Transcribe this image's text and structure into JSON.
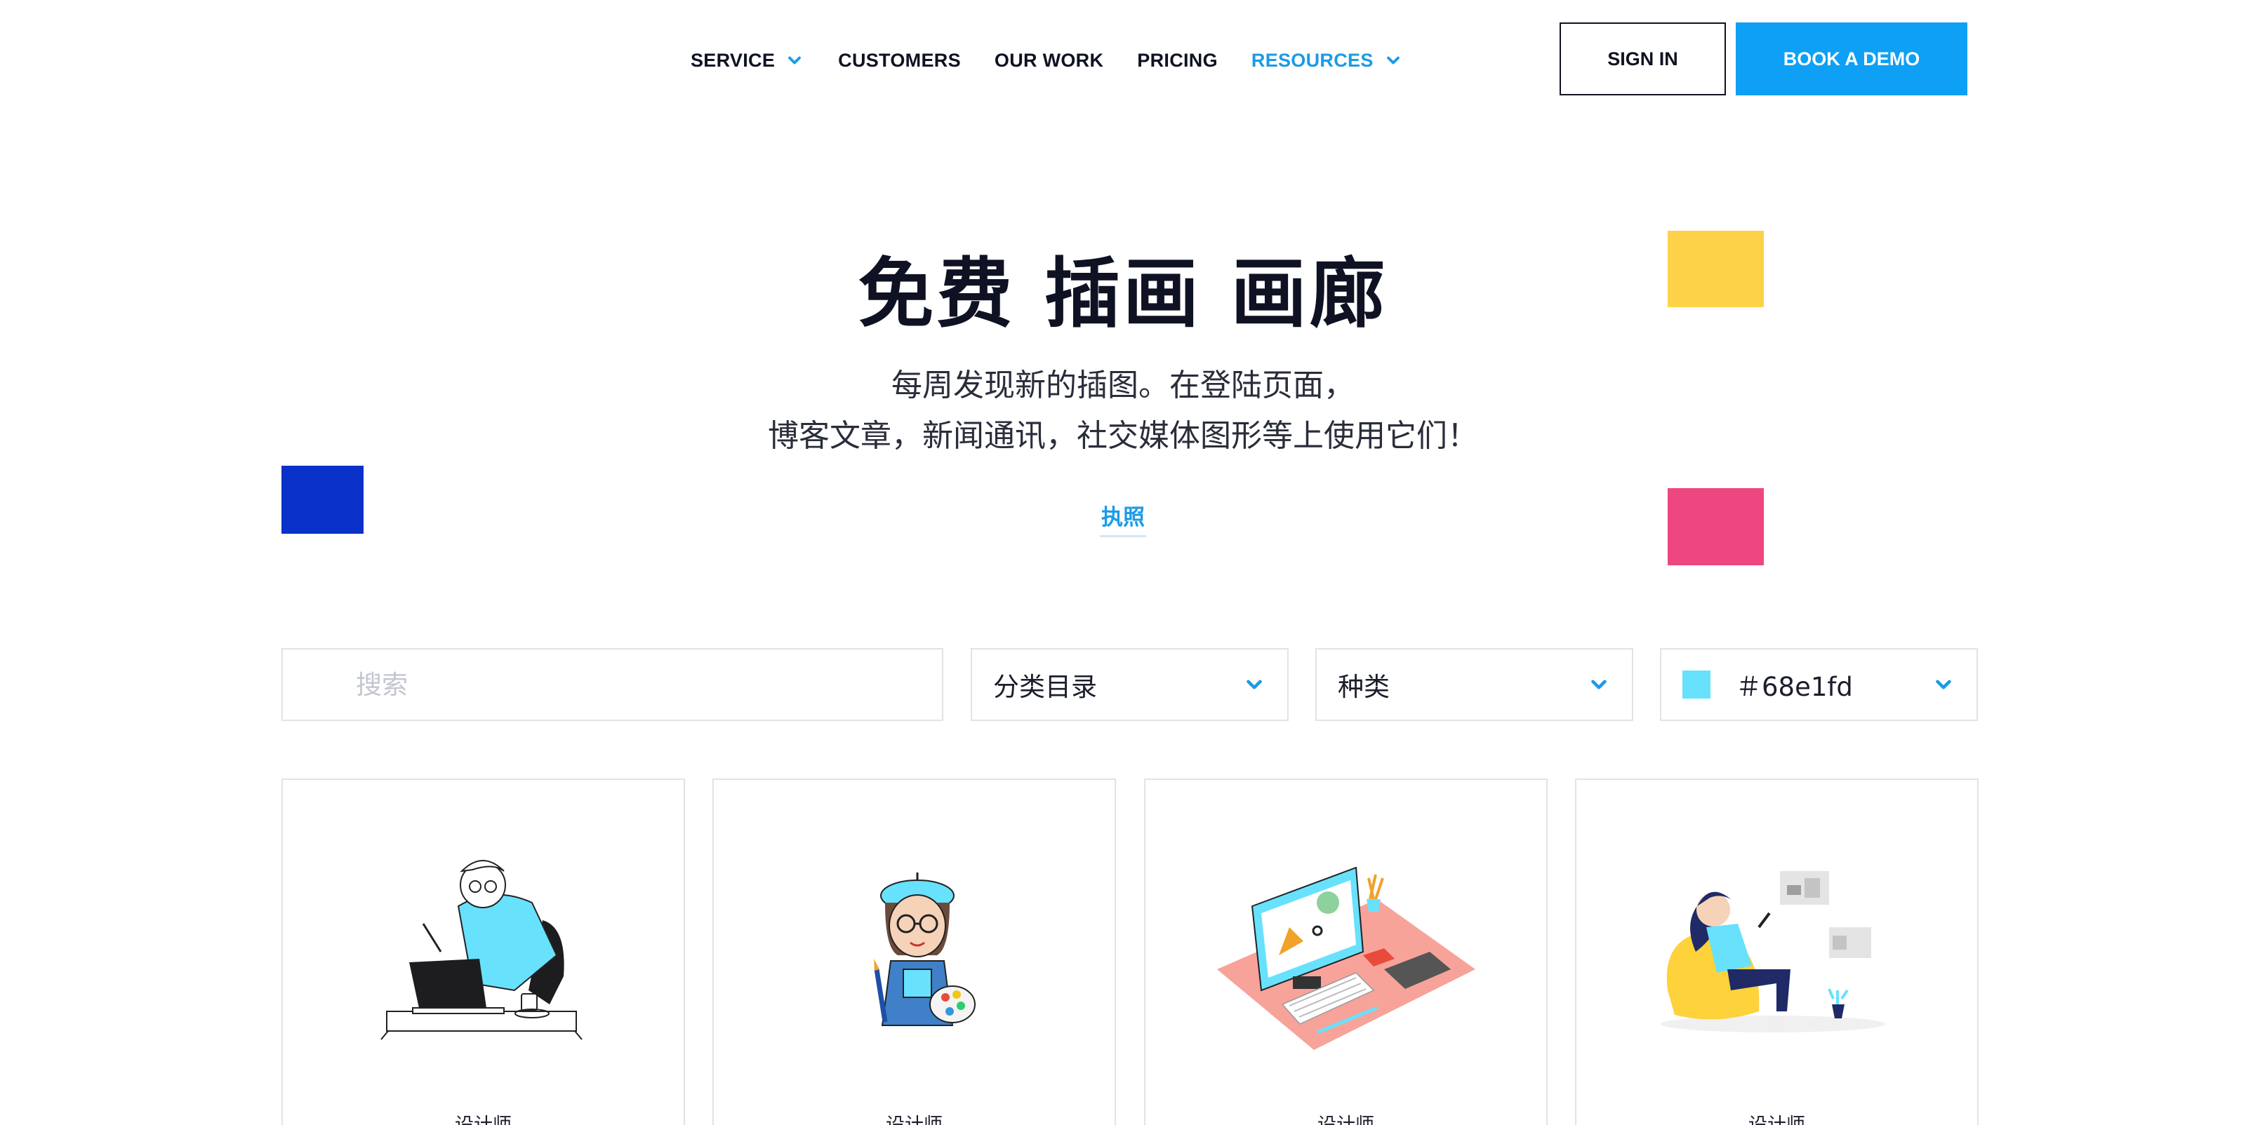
{
  "header": {
    "nav": [
      {
        "label": "SERVICE",
        "has_dropdown": true,
        "active": false
      },
      {
        "label": "CUSTOMERS",
        "has_dropdown": false,
        "active": false
      },
      {
        "label": "OUR WORK",
        "has_dropdown": false,
        "active": false
      },
      {
        "label": "PRICING",
        "has_dropdown": false,
        "active": false
      },
      {
        "label": "RESOURCES",
        "has_dropdown": true,
        "active": true
      }
    ],
    "sign_in": "SIGN IN",
    "book_demo": "BOOK A DEMO"
  },
  "hero": {
    "title": "免费 插画 画廊",
    "subtitle_line1": "每周发现新的插图。在登陆页面，",
    "subtitle_line2": "博客文章，新闻通讯，社交媒体图形等上使用它们！",
    "link": "执照"
  },
  "filters": {
    "search_placeholder": "搜索",
    "category": "分类目录",
    "type": "种类",
    "color_value": "＃68e1fd",
    "color_swatch": "#68e1fd"
  },
  "cards": [
    {
      "label": "设计师",
      "art": "designer-at-laptop-illustration"
    },
    {
      "label": "设计师",
      "art": "artist-with-palette-illustration"
    },
    {
      "label": "设计师",
      "art": "isometric-desk-illustration"
    },
    {
      "label": "设计师",
      "art": "woman-on-beanbag-illustration"
    }
  ],
  "colors": {
    "accent": "#1a9be6",
    "button_primary": "#0ea0f5",
    "deco_blue": "#0a31c8",
    "deco_yellow": "#fdd249",
    "deco_pink": "#ee4680"
  }
}
